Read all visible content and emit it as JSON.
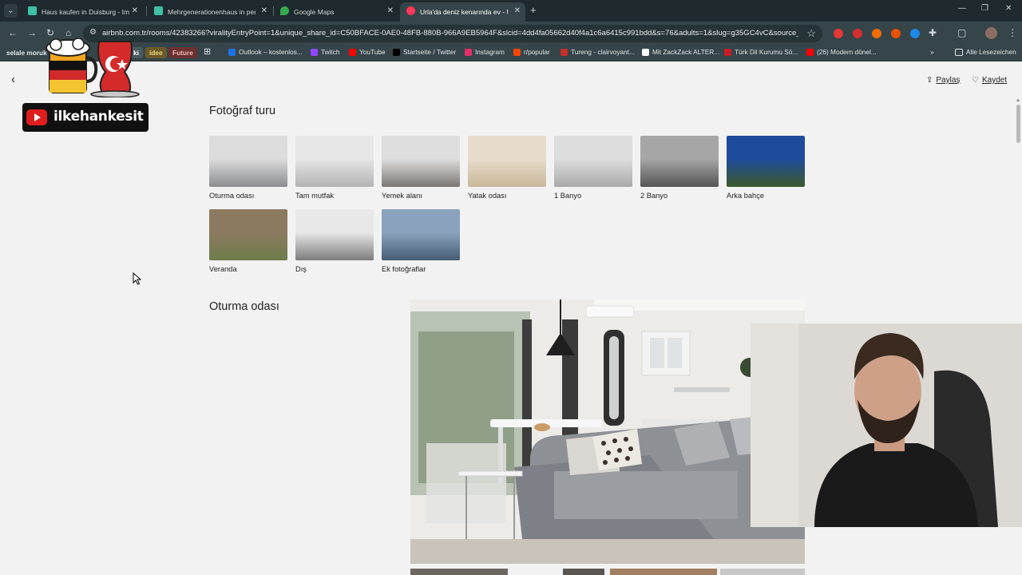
{
  "browser": {
    "tabs": [
      {
        "title": "Haus kaufen in Duisburg - Imm",
        "favicon_color": "#3ec1a6",
        "active": false
      },
      {
        "title": "Mehrgenerationenhaus in perfe",
        "favicon_color": "#3ec1a6",
        "active": false
      },
      {
        "title": "Google Maps",
        "favicon_color": "#34a853",
        "active": false
      },
      {
        "title": "Urla'da deniz kenarında ev - Ur",
        "favicon_color": "#ff385c",
        "active": true
      }
    ],
    "tab_close": "✕",
    "new_tab": "+",
    "url": "airbnb.com.tr/rooms/42383266?viralityEntryPoint=1&unique_share_id=C50BFACE-0AE0-48FB-880B-966A9EB5964F&slcid=4dd4fa05662d40f4a1c6a6415c991bdd&s=76&adults=1&slug=g35GC4vC&source_impr...",
    "bookmarks": {
      "chips": [
        {
          "label": "selale moruk",
          "bg": "#364549",
          "fg": "#dfe6e7"
        },
        {
          "label": "ki",
          "bg": "#4a5b60",
          "fg": "#ffffff"
        },
        {
          "label": "idee",
          "bg": "#6b5a2a",
          "fg": "#f2d77a"
        },
        {
          "label": "Future",
          "bg": "#6a3030",
          "fg": "#f3b8b8"
        }
      ],
      "items": [
        {
          "label": "Outlook – kostenlos...",
          "color": "#1a73e8"
        },
        {
          "label": "Twitch",
          "color": "#9146ff"
        },
        {
          "label": "YouTube",
          "color": "#ff0000"
        },
        {
          "label": "Startseite / Twitter",
          "color": "#000000"
        },
        {
          "label": "Instagram",
          "color": "#e1306c"
        },
        {
          "label": "r/popular",
          "color": "#ff4500"
        },
        {
          "label": "Tureng - clairvoyant...",
          "color": "#c4302b"
        },
        {
          "label": "Mit ZackZack ALTER...",
          "color": "#ffffff"
        },
        {
          "label": "Türk Dil Kurumu Sö...",
          "color": "#c81d25"
        },
        {
          "label": "(26) Modern dönel...",
          "color": "#ff0000"
        }
      ],
      "more": "»",
      "all_bookmarks": "Alle Lesezeichen"
    }
  },
  "page": {
    "back_icon": "‹",
    "share_label": "Paylaş",
    "save_label": "Kaydet",
    "tour_title": "Fotoğraf turu",
    "thumbnails": [
      {
        "caption": "Oturma odası",
        "top": "#dcdcdc",
        "bottom": "#8c8d8f"
      },
      {
        "caption": "Tam mutfak",
        "top": "#e6e6e6",
        "bottom": "#b3b3b3"
      },
      {
        "caption": "Yemek alanı",
        "top": "#dedede",
        "bottom": "#7a7672"
      },
      {
        "caption": "Yatak odası",
        "top": "#e7dccb",
        "bottom": "#c9b79a"
      },
      {
        "caption": "1 Banyo",
        "top": "#dddddd",
        "bottom": "#a9a9a9"
      },
      {
        "caption": "2 Banyo",
        "top": "#a6a6a6",
        "bottom": "#555555"
      },
      {
        "caption": "Arka bahçe",
        "top": "#1e4b9c",
        "bottom": "#3b5a2b"
      },
      {
        "caption": "Veranda",
        "top": "#8c7a60",
        "bottom": "#6e7b4a"
      },
      {
        "caption": "Dış",
        "top": "#e8e8e8",
        "bottom": "#7c7c7c"
      },
      {
        "caption": "Ek fotoğraflar",
        "top": "#8aa2bd",
        "bottom": "#445d73"
      }
    ],
    "room_title": "Oturma odası"
  },
  "overlay": {
    "channel_name": "ilkehankesit"
  }
}
